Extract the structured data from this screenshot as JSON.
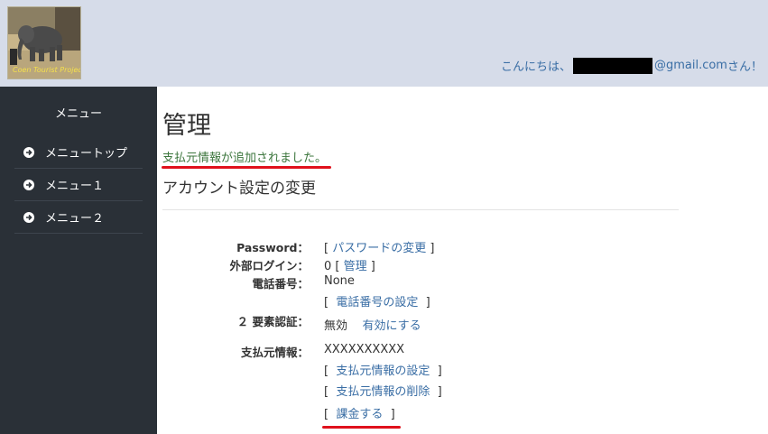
{
  "header": {
    "greeting_prefix": "こんにちは、",
    "greeting_email_suffix": "@gmail.com",
    "greeting_suffix": " さん！",
    "logo_caption": "Coen Tourist Project"
  },
  "sidebar": {
    "title": "メニュー",
    "items": [
      {
        "label": "メニュートップ"
      },
      {
        "label": "メニュー１"
      },
      {
        "label": "メニュー２"
      }
    ]
  },
  "main": {
    "title": "管理",
    "status_message": "支払元情報が追加されました。",
    "section_title": "アカウント設定の変更",
    "fields": {
      "password": {
        "label": "Password：",
        "link": "パスワードの変更"
      },
      "external_login": {
        "label": "外部ログイン：",
        "count": "0",
        "link": "管理"
      },
      "phone": {
        "label": "電話番号：",
        "value": "None",
        "link": "電話番号の設定"
      },
      "two_factor": {
        "label": "２ 要素認証：",
        "value": "無効",
        "link": "有効にする"
      },
      "payment": {
        "label": "支払元情報：",
        "value": "XXXXXXXXXX",
        "link_set": "支払元情報の設定",
        "link_delete": "支払元情報の削除",
        "link_charge": "課金する"
      }
    }
  },
  "colors": {
    "header_bg": "#d6dce9",
    "sidebar_bg": "#2a3037",
    "link": "#3a6ea5",
    "success": "#3c763d",
    "highlight_underline": "#e0111c"
  }
}
